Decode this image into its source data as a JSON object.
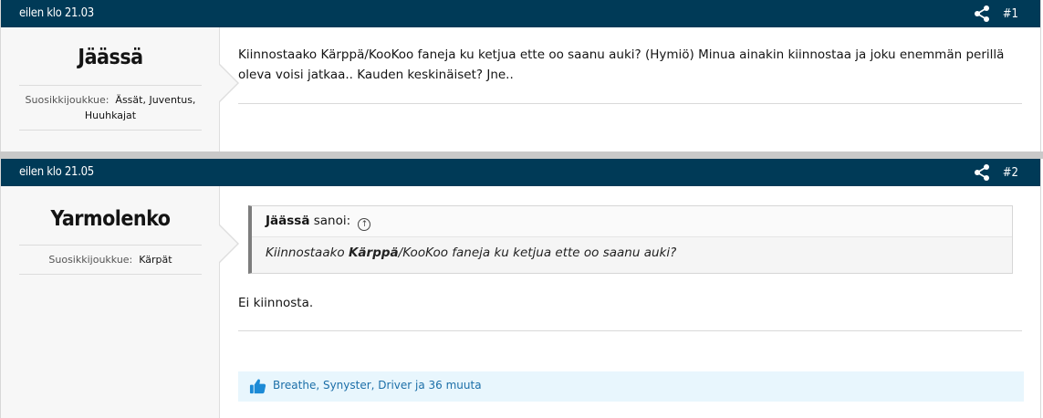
{
  "posts": [
    {
      "date": "eilen klo 21.03",
      "number": "#1",
      "author": "Jäässä",
      "fav_label": "Suosikkijoukkue:",
      "fav_value": "Ässät, Juventus, Huuhkajat",
      "body": "Kiinnostaako Kärppä/KooKoo faneja ku ketjua ette oo saanu auki? (Hymiö) Minua ainakin kiinnostaa ja joku enemmän perillä oleva voisi jatkaa.. Kauden keskinäiset? Jne.."
    },
    {
      "date": "eilen klo 21.05",
      "number": "#2",
      "author": "Yarmolenko",
      "fav_label": "Suosikkijoukkue:",
      "fav_value": "Kärpät",
      "quote": {
        "author": "Jäässä",
        "said": "sanoi:",
        "text_before": "Kiinnostaako ",
        "text_bold": "Kärppä",
        "text_after": "/KooKoo faneja ku ketjua ette oo saanu auki?"
      },
      "body": "Ei kiinnosta.",
      "likes": "Breathe, Synyster, Driver ja 36 muuta"
    }
  ],
  "icons": {
    "share": "share-icon",
    "like": "thumbs-up-icon",
    "quote_up": "arrow-up-circle-icon"
  },
  "colors": {
    "header": "#003a57",
    "likes_bg": "#e8f6fd",
    "likes_link": "#1c6fa8"
  }
}
